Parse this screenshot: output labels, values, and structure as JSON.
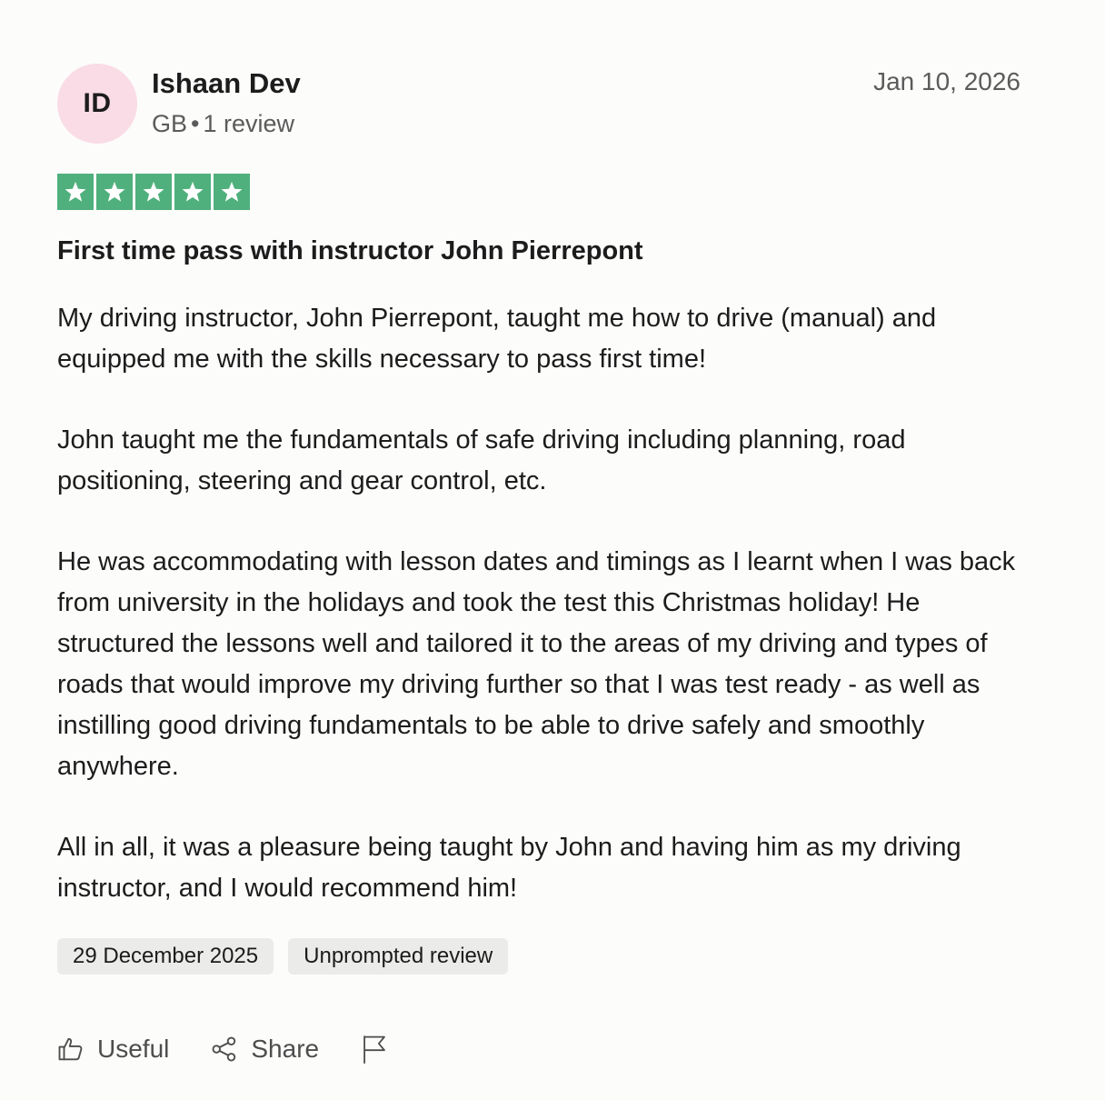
{
  "reviewer": {
    "initials": "ID",
    "name": "Ishaan Dev",
    "country": "GB",
    "separator": "•",
    "review_count": "1 review",
    "avatar_color": "#f9dce6"
  },
  "review": {
    "date": "Jan 10, 2026",
    "rating": 5,
    "star_color": "#4fb07d",
    "title": "First time pass with instructor John Pierrepont",
    "paragraphs": [
      "My driving instructor, John Pierrepont, taught me how to drive (manual) and equipped me with the skills necessary to pass first time!",
      "John taught me the fundamentals of safe driving including planning, road positioning, steering and gear control, etc.",
      "He was accommodating with lesson dates and timings as I learnt when I was back from university in the holidays and took the test this Christmas holiday! He structured the lessons well and tailored it to the areas of my driving and types of roads that would improve my driving further so that I was test ready - as well as instilling good driving fundamentals to be able to drive safely and smoothly anywhere.",
      "All in all, it was a pleasure being taught by John and having him as my driving instructor, and I would recommend him!"
    ],
    "experience_date": "29 December 2025",
    "review_type": "Unprompted review"
  },
  "actions": {
    "useful_label": "Useful",
    "share_label": "Share",
    "useful_icon": "thumbs-up-icon",
    "share_icon": "share-icon",
    "report_icon": "flag-icon"
  }
}
